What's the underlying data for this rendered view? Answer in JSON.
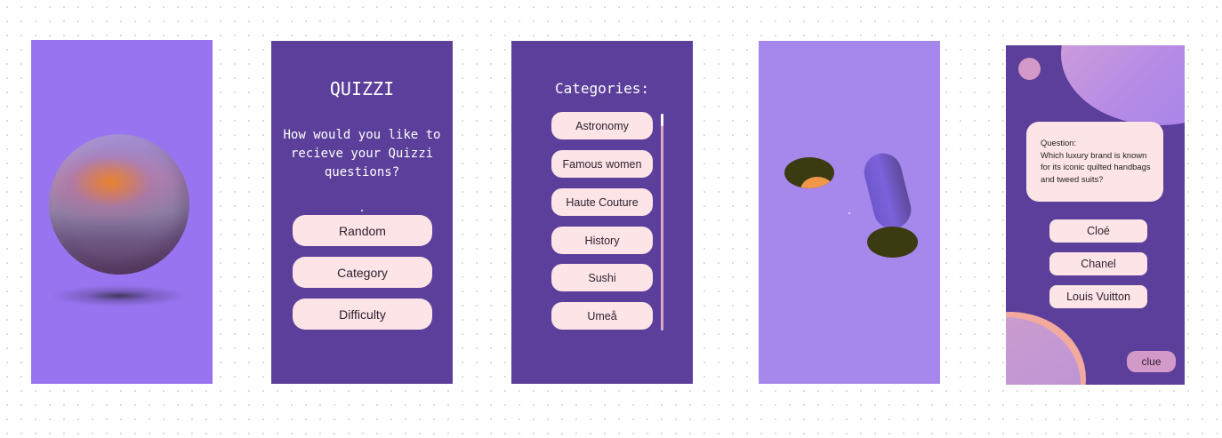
{
  "screens": {
    "welcome": {},
    "mode_select": {
      "title": "QUIZZI",
      "question": "How would you like to recieve your Quizzi questions?",
      "options": [
        "Random",
        "Category",
        "Difficulty"
      ]
    },
    "categories": {
      "title": "Categories:",
      "items": [
        "Astronomy",
        "Famous women",
        "Haute Couture",
        "History",
        "Sushi",
        "Umeå"
      ]
    },
    "transition": {},
    "question": {
      "prompt_label": "Question:",
      "prompt_text": "Which luxury brand is known for its iconic quilted handbags and tweed suits?",
      "answers": [
        "Cloé",
        "Chanel",
        "Louis Vuitton"
      ],
      "clue_label": "clue"
    }
  },
  "colors": {
    "canvas": "#ffffff",
    "frame_light": "#9874f0",
    "frame_dark": "#5b3f9a",
    "frame_lavender": "#a687eb",
    "pill": "#fde4e6",
    "accent_pink": "#d39ac9",
    "orange": "#f0974a",
    "hole": "#3a3b10"
  }
}
